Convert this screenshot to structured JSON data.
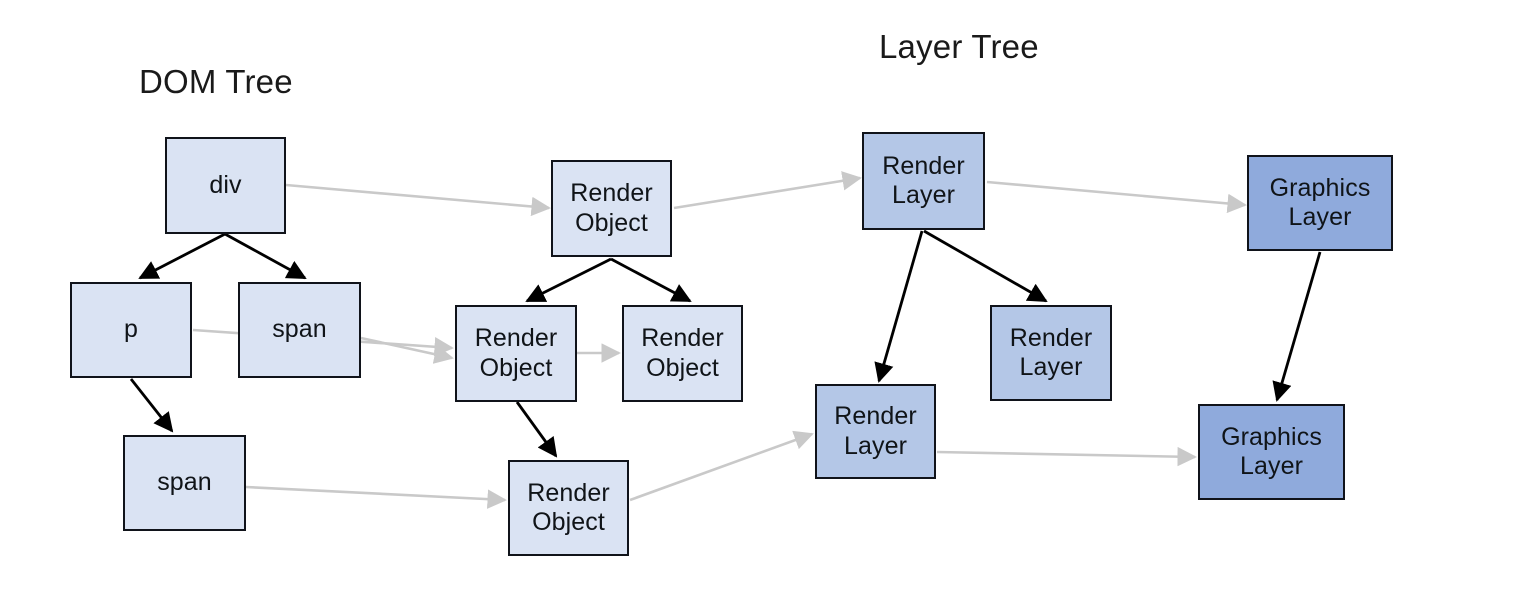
{
  "diagram": {
    "titles": {
      "dom_tree": "DOM Tree",
      "layer_tree": "Layer Tree"
    },
    "colors": {
      "dom_node_fill": "#dae3f3",
      "render_layer_fill": "#b4c7e7",
      "graphics_layer_fill": "#8faadc",
      "node_border": "#10131a",
      "tree_edge": "#000000",
      "mapping_edge": "#c9c9c9",
      "background": "#ffffff"
    },
    "nodes": {
      "dom_div": "div",
      "dom_p": "p",
      "dom_span_1": "span",
      "dom_span_2": "span",
      "render_object_1": "Render\nObject",
      "render_object_2": "Render\nObject",
      "render_object_3": "Render\nObject",
      "render_object_4": "Render\nObject",
      "render_layer_1": "Render\nLayer",
      "render_layer_2": "Render\nLayer",
      "render_layer_3": "Render\nLayer",
      "graphics_layer_1": "Graphics\nLayer",
      "graphics_layer_2": "Graphics\nLayer"
    },
    "node_lines": {
      "render_object_l1": "Render",
      "render_object_l2": "Object",
      "render_layer_l1": "Render",
      "render_layer_l2": "Layer",
      "graphics_layer_l1": "Graphics",
      "graphics_layer_l2": "Layer"
    }
  }
}
